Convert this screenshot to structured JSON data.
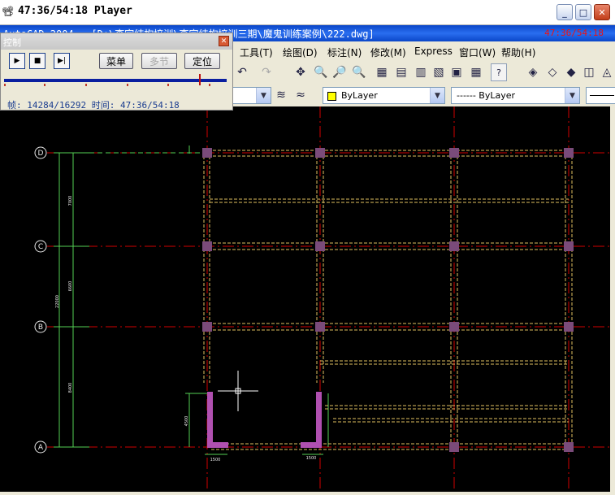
{
  "player": {
    "logo": "📽",
    "title": "47:36/54:18 Player",
    "buttons": {
      "minimize": "_",
      "maximize": "□",
      "close": "✕"
    }
  },
  "cad_window": {
    "title": "AutoCAD 2004 - [D:\\李宗结构培训\\李宗结构培训三期\\魔鬼训练案例\\222.dwg]",
    "time_overlay": "47:36/54:18"
  },
  "menu": {
    "items": [
      "工具(T)",
      "绘图(D)",
      "标注(N)",
      "修改(M)",
      "Express",
      "窗口(W)",
      "帮助(H)"
    ]
  },
  "toolbar": {
    "layer_value": "ByLayer",
    "linetype_value": "------ ByLayer"
  },
  "control_panel": {
    "title": "控制",
    "menu_btn": "菜单",
    "multi_btn": "多节",
    "locate_btn": "定位",
    "status": "帧: 14284/16292 时间: 47:36/54:18",
    "progress": 0.877
  },
  "drawing": {
    "axis_labels": [
      "D",
      "C",
      "B",
      "A"
    ],
    "dimension_labels": [
      "7000",
      "6600",
      "22000",
      "8400",
      "4500",
      "1500",
      "1500"
    ]
  },
  "colors": {
    "beam_yellow": "#e0c060",
    "column_fill": "#7a4b7a",
    "axis_red": "#d00000",
    "dim_green": "#55d055",
    "wall_purple": "#b050b0"
  }
}
